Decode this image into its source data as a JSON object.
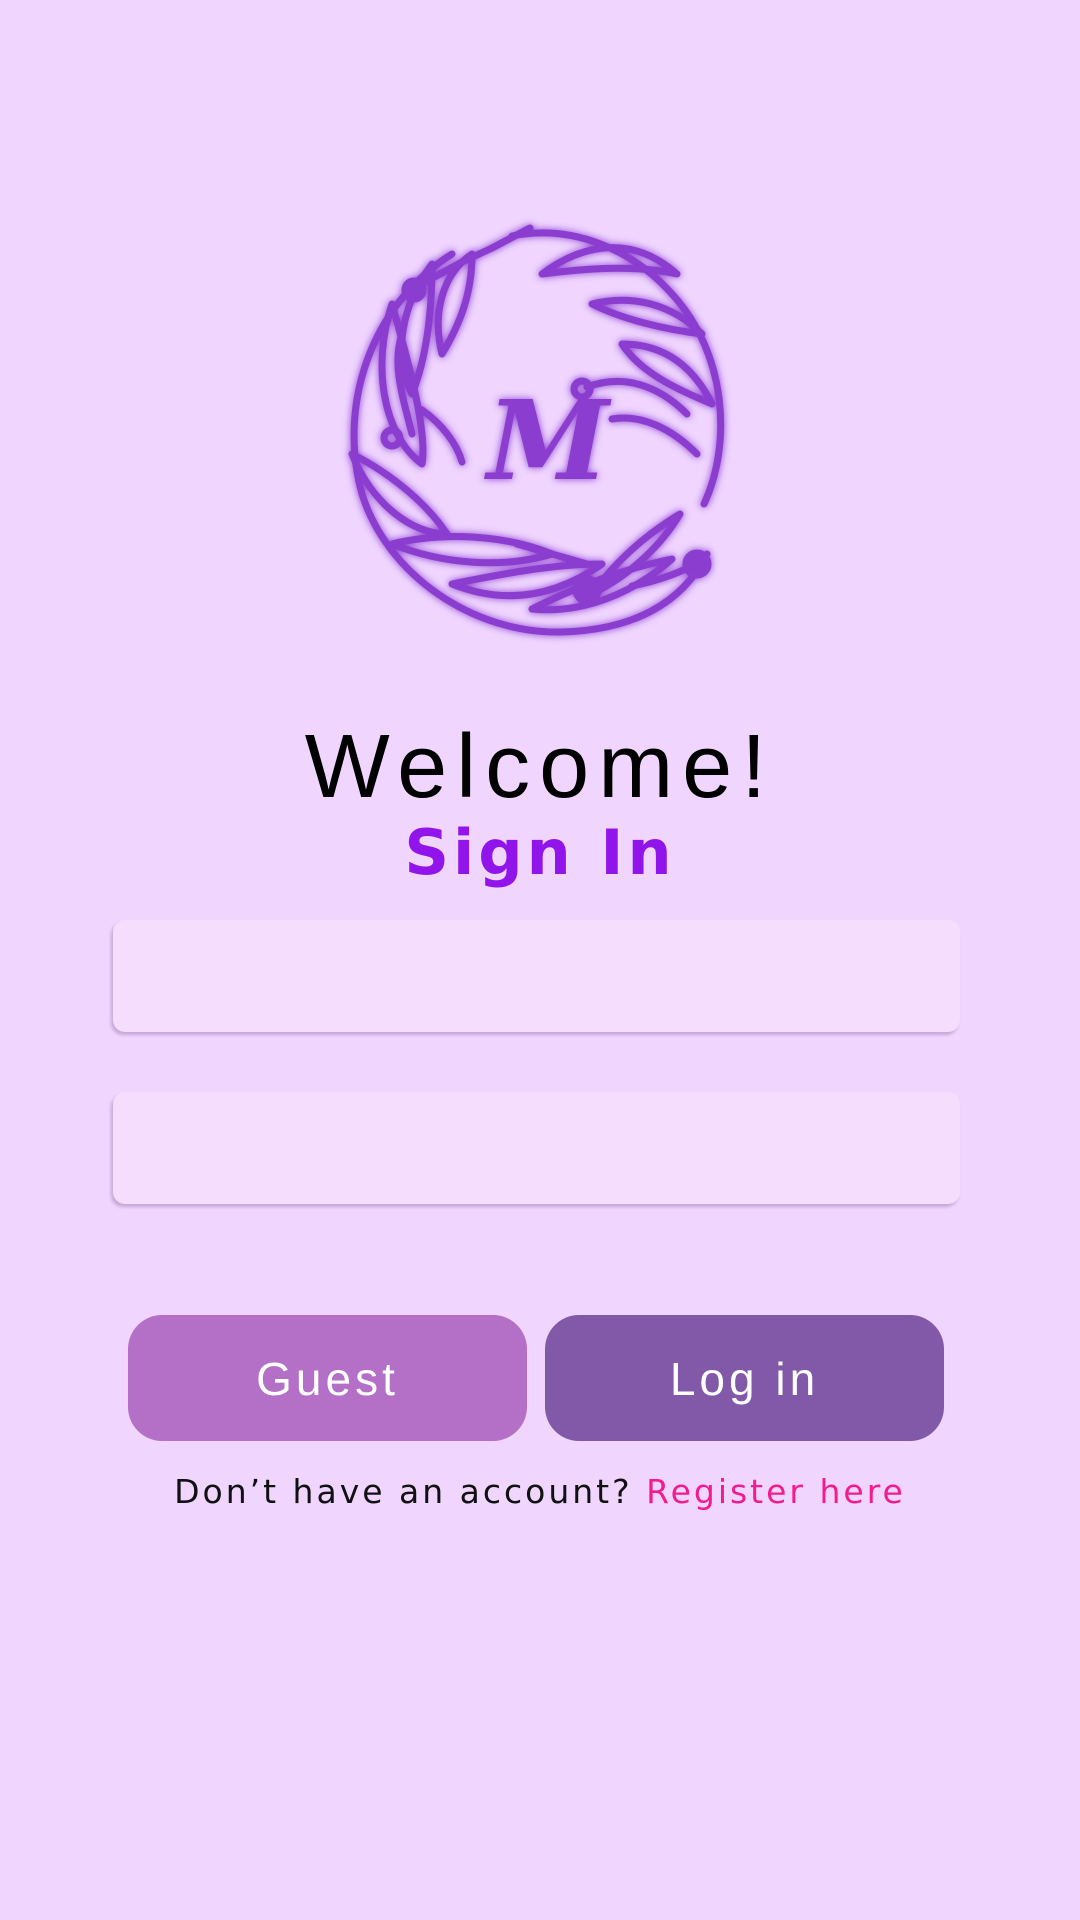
{
  "logo": {
    "letter": "M",
    "icon": "floral-monogram-logo",
    "color": "#8a3ccf"
  },
  "header": {
    "welcome": "Welcome!",
    "title": "Sign In"
  },
  "form": {
    "username_value": "",
    "password_value": ""
  },
  "buttons": {
    "guest_label": "Guest",
    "login_label": "Log in"
  },
  "register": {
    "prompt": "Don’t have an account?",
    "link_label": "Register here"
  },
  "colors": {
    "background": "#f0d6ff",
    "accent": "#9115eb",
    "guest_button": "#b470c7",
    "login_button": "#8159a8",
    "link": "#f21c8c"
  }
}
